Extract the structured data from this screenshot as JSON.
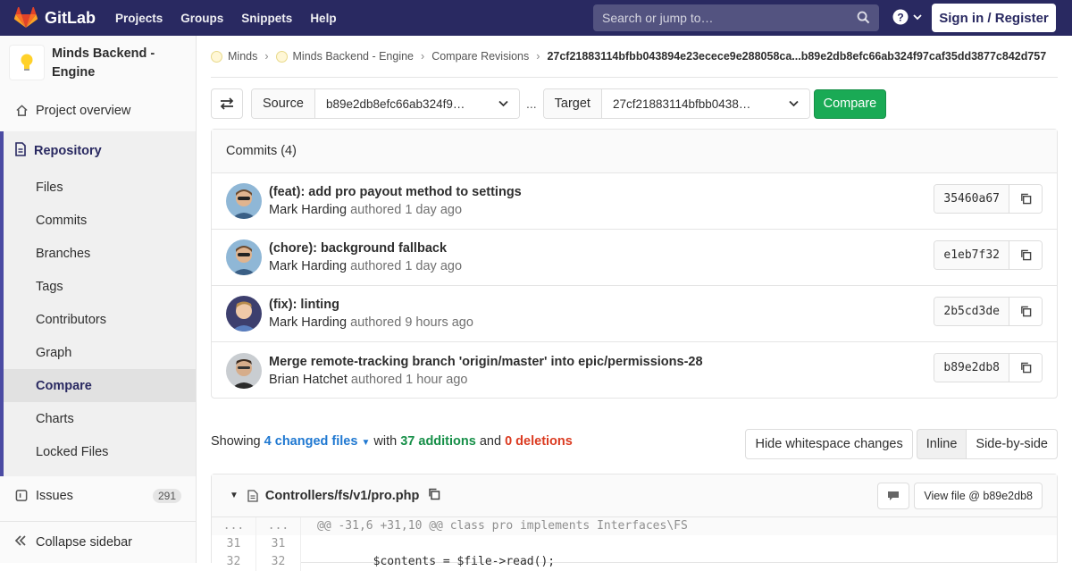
{
  "navbar": {
    "brand": "GitLab",
    "links": [
      "Projects",
      "Groups",
      "Snippets",
      "Help"
    ],
    "search_placeholder": "Search or jump to…",
    "signin": "Sign in / Register"
  },
  "sidebar": {
    "project_name": "Minds Backend - Engine",
    "overview": "Project overview",
    "repository": "Repository",
    "repo_items": [
      "Files",
      "Commits",
      "Branches",
      "Tags",
      "Contributors",
      "Graph",
      "Compare",
      "Charts",
      "Locked Files"
    ],
    "active_item": "Compare",
    "issues": "Issues",
    "issues_count": "291",
    "collapse": "Collapse sidebar"
  },
  "breadcrumb": {
    "items": [
      "Minds",
      "Minds Backend - Engine",
      "Compare Revisions"
    ],
    "current": "27cf21883114bfbb043894e23ecece9e288058ca...b89e2db8efc66ab324f97caf35dd3877c842d757"
  },
  "compare": {
    "source_label": "Source",
    "source_value": "b89e2db8efc66ab324f9…",
    "dots": "...",
    "target_label": "Target",
    "target_value": "27cf21883114bfbb0438…",
    "button": "Compare"
  },
  "commits": {
    "header": "Commits (4)",
    "list": [
      {
        "title": "(feat): add pro payout method to settings",
        "author": "Mark Harding",
        "meta": "authored 1 day ago",
        "sha": "35460a67"
      },
      {
        "title": "(chore): background fallback",
        "author": "Mark Harding",
        "meta": "authored 1 day ago",
        "sha": "e1eb7f32"
      },
      {
        "title": "(fix): linting",
        "author": "Mark Harding",
        "meta": "authored 9 hours ago",
        "sha": "2b5cd3de"
      },
      {
        "title": "Merge remote-tracking branch 'origin/master' into epic/permissions-28",
        "author": "Brian Hatchet",
        "meta": "authored 1 hour ago",
        "sha": "b89e2db8"
      }
    ]
  },
  "summary": {
    "showing": "Showing",
    "files": "4 changed files",
    "with": "with",
    "additions": "37 additions",
    "and": "and",
    "deletions": "0 deletions"
  },
  "diff_controls": {
    "whitespace": "Hide whitespace changes",
    "inline": "Inline",
    "side_by_side": "Side-by-side"
  },
  "file": {
    "name": "Controllers/fs/v1/pro.php",
    "view_file": "View file @ b89e2db8",
    "lines": [
      {
        "old": "...",
        "new": "...",
        "code": "@@ -31,6 +31,10 @@ class pro implements Interfaces\\FS"
      },
      {
        "old": "31",
        "new": "31",
        "code": ""
      },
      {
        "old": "32",
        "new": "32",
        "code": "        $contents = $file->read();"
      }
    ]
  },
  "colors": {
    "navbar": "#292961",
    "accent": "#4b4ba3",
    "compare_button": "#1aaa55",
    "additions": "#168f48",
    "deletions": "#db3b21",
    "link": "#1f78d1"
  }
}
